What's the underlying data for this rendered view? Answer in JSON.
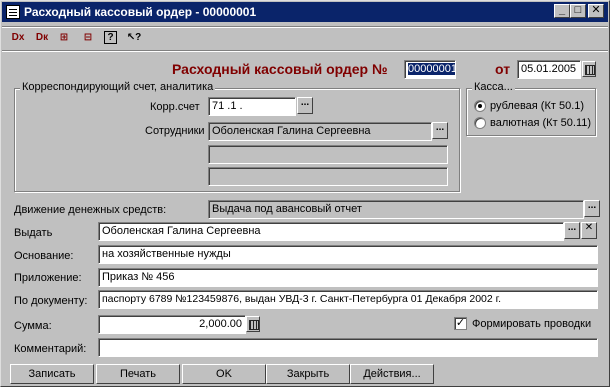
{
  "window": {
    "title": "Расходный кассовый ордер - 00000001"
  },
  "titlebar_buttons": [
    "_",
    "□",
    "✕"
  ],
  "toolbar": [
    {
      "name": "dx-delete-icon",
      "glyph": "Dx"
    },
    {
      "name": "dk-icon",
      "glyph": "Dк"
    },
    {
      "name": "struct-icon",
      "glyph": "⊞"
    },
    {
      "name": "tree-icon",
      "glyph": "⊟"
    },
    {
      "name": "help-icon",
      "glyph": "?"
    },
    {
      "name": "whatsthis-icon",
      "glyph": "↖?"
    }
  ],
  "header": {
    "title": "Расходный кассовый ордер №",
    "number": "00000001",
    "date_label": "от",
    "date": "05.01.2005"
  },
  "corr_group": {
    "title": "Корреспондирующий счет, аналитика",
    "account_label": "Корр.счет",
    "account_value": "71 .1 .",
    "employees_label": "Сотрудники",
    "employees_value": "Оболенская Галина Сергеевна"
  },
  "kassa_group": {
    "title": "Касса...",
    "option1": "рублевая (Кт 50.1)",
    "option2": "валютная (Кт 50.11)"
  },
  "form": {
    "movement_label": "Движение денежных средств:",
    "movement_value": "Выдача под авансовый отчет",
    "issue_label": "Выдать",
    "issue_value": "Оболенская Галина Сергеевна",
    "basis_label": "Основание:",
    "basis_value": "на хозяйственные нужды",
    "attachment_label": "Приложение:",
    "attachment_value": "Приказ № 456",
    "document_label": "По документу:",
    "document_value": "паспорту 6789 №123459876, выдан УВД-3 г. Санкт-Петербурга 01 Декабря 2002 г.",
    "sum_label": "Сумма:",
    "sum_value": "2,000.00",
    "postings_label": "Формировать проводки",
    "comment_label": "Комментарий:",
    "comment_value": ""
  },
  "buttons": {
    "write": "Записать",
    "print": "Печать",
    "ok": "OK",
    "close": "Закрыть",
    "actions": "Действия..."
  },
  "colors": {
    "titlebar": "#0a246a",
    "heading": "#800000",
    "face": "#c0c0c0"
  }
}
